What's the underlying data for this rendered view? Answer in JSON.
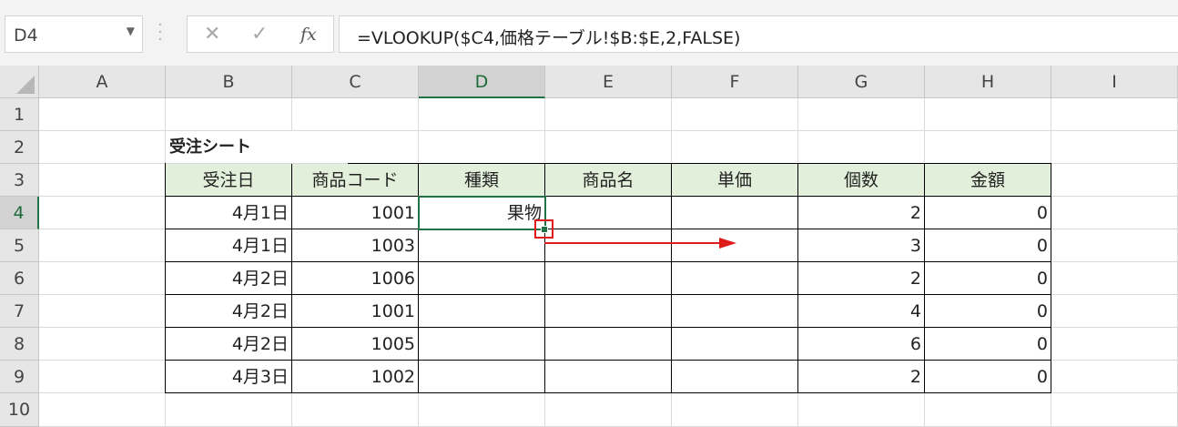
{
  "name_box": {
    "value": "D4"
  },
  "formula_bar": {
    "cancel_icon": "✕",
    "enter_icon": "✓",
    "fx_label": "fx",
    "formula": "=VLOOKUP($C4,価格テーブル!$B:$E,2,FALSE)"
  },
  "columns": [
    "A",
    "B",
    "C",
    "D",
    "E",
    "F",
    "G",
    "H",
    "I"
  ],
  "selected_column": "D",
  "rows": [
    "1",
    "2",
    "3",
    "4",
    "5",
    "6",
    "7",
    "8",
    "9",
    "10"
  ],
  "selected_row": "4",
  "sheet_title": "受注シート",
  "table": {
    "headers": [
      "受注日",
      "商品コード",
      "種類",
      "商品名",
      "単価",
      "個数",
      "金額"
    ],
    "rows": [
      [
        "4月1日",
        "1001",
        "果物",
        "",
        "",
        "2",
        "0"
      ],
      [
        "4月1日",
        "1003",
        "",
        "",
        "",
        "3",
        "0"
      ],
      [
        "4月2日",
        "1006",
        "",
        "",
        "",
        "2",
        "0"
      ],
      [
        "4月2日",
        "1001",
        "",
        "",
        "",
        "4",
        "0"
      ],
      [
        "4月2日",
        "1005",
        "",
        "",
        "",
        "6",
        "0"
      ],
      [
        "4月3日",
        "1002",
        "",
        "",
        "",
        "2",
        "0"
      ]
    ]
  },
  "annotation": {
    "color": "#e01b1b"
  }
}
